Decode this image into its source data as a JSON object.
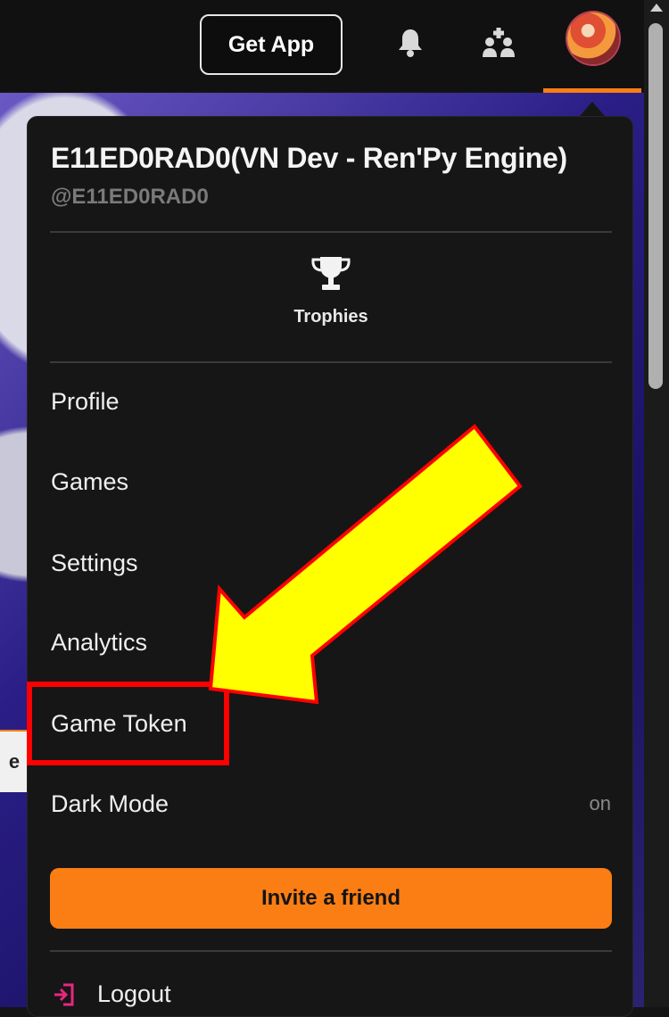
{
  "topbar": {
    "get_app_label": "Get App",
    "bell_icon": "bell-icon",
    "people_icon": "people-icon",
    "accent_color": "#fa7e14"
  },
  "menu": {
    "user_name": "E11ED0RAD0(VN Dev - Ren'Py Engine)",
    "user_handle": "@E11ED0RAD0",
    "trophies_label": "Trophies",
    "items": [
      "Profile",
      "Games",
      "Settings",
      "Analytics",
      "Game Token"
    ],
    "dark_mode_label": "Dark Mode",
    "dark_mode_value": "on",
    "invite_label": "Invite a friend",
    "logout_label": "Logout"
  },
  "background": {
    "partial_label": "e"
  },
  "annotation": {
    "highlighted_item": "Game Token",
    "arrow_color": "#ffff00",
    "outline_color": "#ff0000"
  }
}
